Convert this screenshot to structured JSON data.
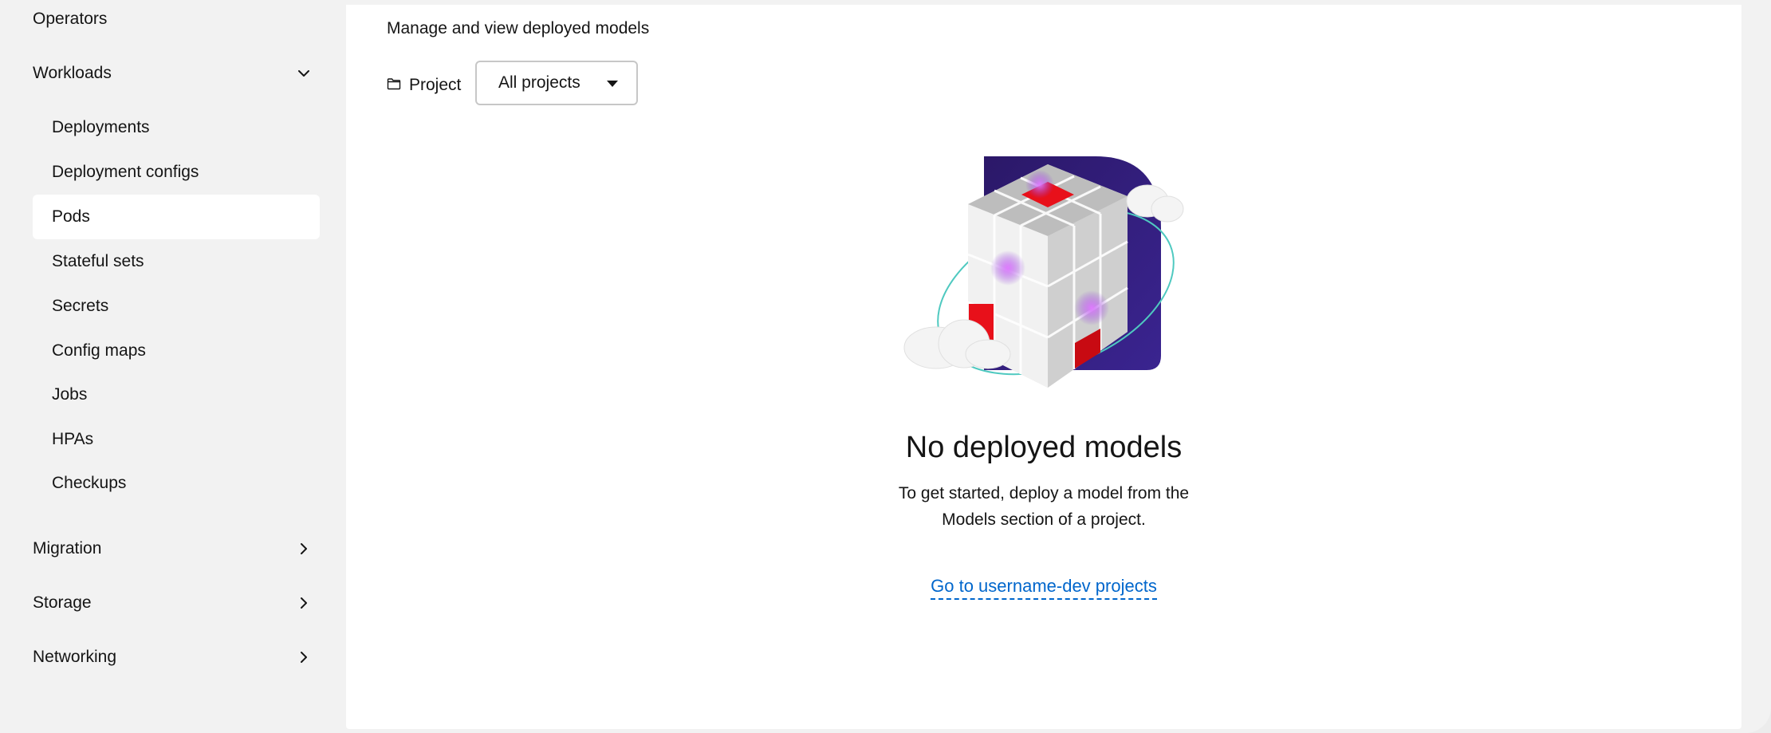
{
  "sidebar": {
    "sections": [
      {
        "label": "Operators",
        "chevron": "none"
      },
      {
        "label": "Workloads",
        "chevron": "chevron-down-icon"
      },
      {
        "label": "Migration",
        "chevron": "chevron-right-icon"
      },
      {
        "label": "Storage",
        "chevron": "chevron-right-icon"
      },
      {
        "label": "Networking",
        "chevron": "chevron-right-icon"
      }
    ],
    "workloads_items": [
      {
        "label": "Deployments"
      },
      {
        "label": "Deployment configs"
      },
      {
        "label": "Pods",
        "active": true
      },
      {
        "label": "Stateful sets"
      },
      {
        "label": "Secrets"
      },
      {
        "label": "Config maps"
      },
      {
        "label": "Jobs"
      },
      {
        "label": "HPAs"
      },
      {
        "label": "Checkups"
      }
    ]
  },
  "main": {
    "subtitle": "Manage and view deployed models",
    "project_label": "Project",
    "project_icon": "folder-icon",
    "project_select": {
      "value": "All projects",
      "icon": "caret-down-icon"
    },
    "empty_state": {
      "illustration": "cube-illustration",
      "title": "No deployed models",
      "body": "To get started, deploy a model from the Models section of a project.",
      "link": "Go to username-dev projects"
    }
  },
  "colors": {
    "link": "#0066cc",
    "illustration_bg": "#2a1a6e",
    "accent_red": "#e00000",
    "sidebar_bg": "#f2f2f2"
  }
}
